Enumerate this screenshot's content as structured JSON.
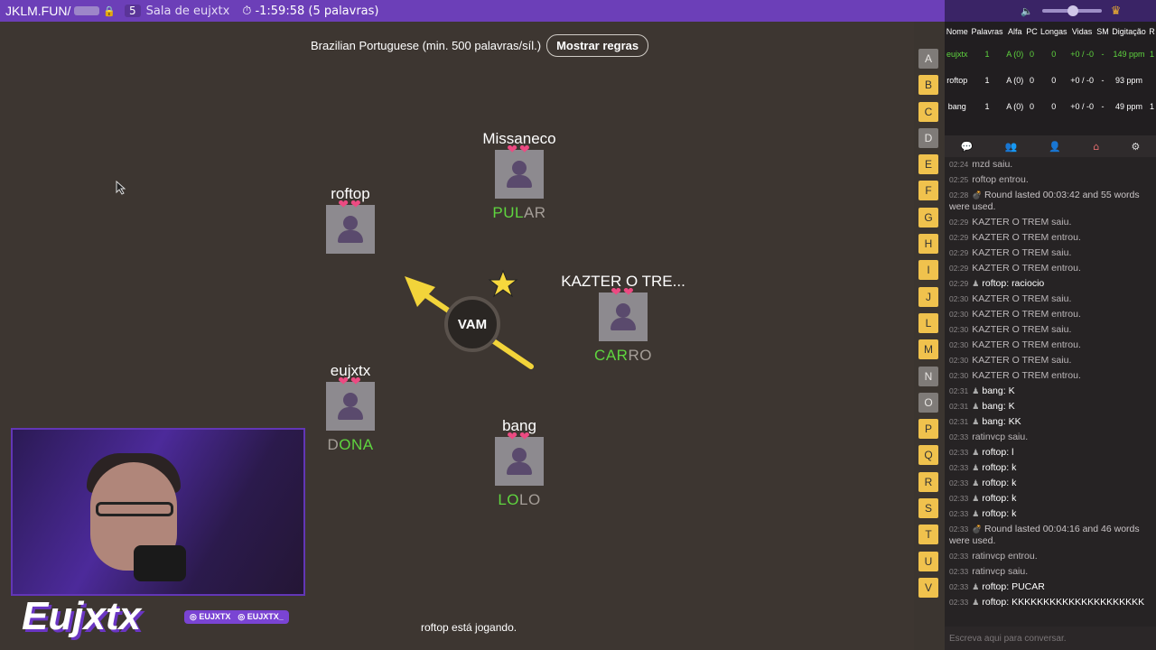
{
  "topbar": {
    "site": "JKLM.FUN/",
    "room_count": "5",
    "room_name": "Sala de eujxtx",
    "timer": "-1:59:58 (5 palavras)"
  },
  "game": {
    "language_rule": "Brazilian Portuguese (min. 500 palavras/síl.)",
    "rules_button": "Mostrar regras",
    "syllable": "VAM",
    "status": "roftop está jogando.",
    "players": [
      {
        "name": "Missaneco",
        "hearts": "❤❤",
        "word_done": "PUL",
        "word_rest": "AR"
      },
      {
        "name": "roftop",
        "hearts": "❤❤",
        "word_done": "",
        "word_rest": ""
      },
      {
        "name": "KAZTER O TRE...",
        "hearts": "❤❤",
        "word_done": "CAR",
        "word_rest": "RO"
      },
      {
        "name": "eujxtx",
        "hearts": "❤❤",
        "word_done": "",
        "word_rest": ""
      },
      {
        "name": "bang",
        "hearts": "❤❤",
        "word_done": "LO",
        "word_rest": "LO"
      }
    ],
    "eujxtx_word": {
      "d": "D",
      "rest": "ONA"
    }
  },
  "stream": {
    "logo": "Eujxtx",
    "tag1": "◎ EUJXTX",
    "tag2": "◎ EUJXTX_"
  },
  "letters": [
    {
      "l": "A",
      "used": true
    },
    {
      "l": "B",
      "used": false
    },
    {
      "l": "C",
      "used": false
    },
    {
      "l": "D",
      "used": true
    },
    {
      "l": "E",
      "used": false
    },
    {
      "l": "F",
      "used": false
    },
    {
      "l": "G",
      "used": false
    },
    {
      "l": "H",
      "used": false
    },
    {
      "l": "I",
      "used": false
    },
    {
      "l": "J",
      "used": false
    },
    {
      "l": "L",
      "used": false
    },
    {
      "l": "M",
      "used": false
    },
    {
      "l": "N",
      "used": true
    },
    {
      "l": "O",
      "used": true
    },
    {
      "l": "P",
      "used": false
    },
    {
      "l": "Q",
      "used": false
    },
    {
      "l": "R",
      "used": false
    },
    {
      "l": "S",
      "used": false
    },
    {
      "l": "T",
      "used": false
    },
    {
      "l": "U",
      "used": false
    },
    {
      "l": "V",
      "used": false
    }
  ],
  "scoreboard": {
    "headers": [
      "Nome",
      "Palavras",
      "Alfa",
      "PC",
      "Longas",
      "Vidas",
      "SM",
      "Digitação",
      "R"
    ],
    "rows": [
      [
        "eujxtx",
        "1",
        "A (0)",
        "0",
        "0",
        "+0 / -0",
        "-",
        "149 ppm",
        "1"
      ],
      [
        "roftop",
        "1",
        "A (0)",
        "0",
        "0",
        "+0 / -0",
        "-",
        "93 ppm",
        ""
      ],
      [
        "bang",
        "1",
        "A (0)",
        "0",
        "0",
        "+0 / -0",
        "-",
        "49 ppm",
        "1"
      ]
    ]
  },
  "chat": [
    {
      "t": "02:24",
      "type": "sys",
      "text": "mzd saiu."
    },
    {
      "t": "02:25",
      "type": "sys",
      "text": "roftop entrou."
    },
    {
      "t": "02:28",
      "type": "round",
      "text": "Round lasted 00:03:42 and 55 words were used."
    },
    {
      "t": "02:29",
      "type": "sys",
      "text": "KAZTER O TREM saiu."
    },
    {
      "t": "02:29",
      "type": "sys",
      "text": "KAZTER O TREM entrou."
    },
    {
      "t": "02:29",
      "type": "sys",
      "text": "KAZTER O TREM saiu."
    },
    {
      "t": "02:29",
      "type": "sys",
      "text": "KAZTER O TREM entrou."
    },
    {
      "t": "02:29",
      "type": "user",
      "user": "roftop",
      "text": "raciocio"
    },
    {
      "t": "02:30",
      "type": "sys",
      "text": "KAZTER O TREM saiu."
    },
    {
      "t": "02:30",
      "type": "sys",
      "text": "KAZTER O TREM entrou."
    },
    {
      "t": "02:30",
      "type": "sys",
      "text": "KAZTER O TREM saiu."
    },
    {
      "t": "02:30",
      "type": "sys",
      "text": "KAZTER O TREM entrou."
    },
    {
      "t": "02:30",
      "type": "sys",
      "text": "KAZTER O TREM saiu."
    },
    {
      "t": "02:30",
      "type": "sys",
      "text": "KAZTER O TREM entrou."
    },
    {
      "t": "02:31",
      "type": "user",
      "user": "bang",
      "text": "K"
    },
    {
      "t": "02:31",
      "type": "user",
      "user": "bang",
      "text": "K"
    },
    {
      "t": "02:31",
      "type": "user",
      "user": "bang",
      "text": "KK"
    },
    {
      "t": "02:33",
      "type": "sys",
      "text": "ratinvcp saiu."
    },
    {
      "t": "02:33",
      "type": "user",
      "user": "roftop",
      "text": "l"
    },
    {
      "t": "02:33",
      "type": "user",
      "user": "roftop",
      "text": "k"
    },
    {
      "t": "02:33",
      "type": "user",
      "user": "roftop",
      "text": "k"
    },
    {
      "t": "02:33",
      "type": "user",
      "user": "roftop",
      "text": "k"
    },
    {
      "t": "02:33",
      "type": "user",
      "user": "roftop",
      "text": "k"
    },
    {
      "t": "02:33",
      "type": "round",
      "text": "Round lasted 00:04:16 and 46 words were used."
    },
    {
      "t": "02:33",
      "type": "sys",
      "text": "ratinvcp entrou."
    },
    {
      "t": "02:33",
      "type": "sys",
      "text": "ratinvcp saiu."
    },
    {
      "t": "02:33",
      "type": "user",
      "user": "roftop",
      "text": "PUCAR"
    },
    {
      "t": "02:33",
      "type": "user",
      "user": "roftop",
      "text": "KKKKKKKKKKKKKKKKKKKKK"
    }
  ],
  "chat_placeholder": "Escreva aqui para conversar."
}
